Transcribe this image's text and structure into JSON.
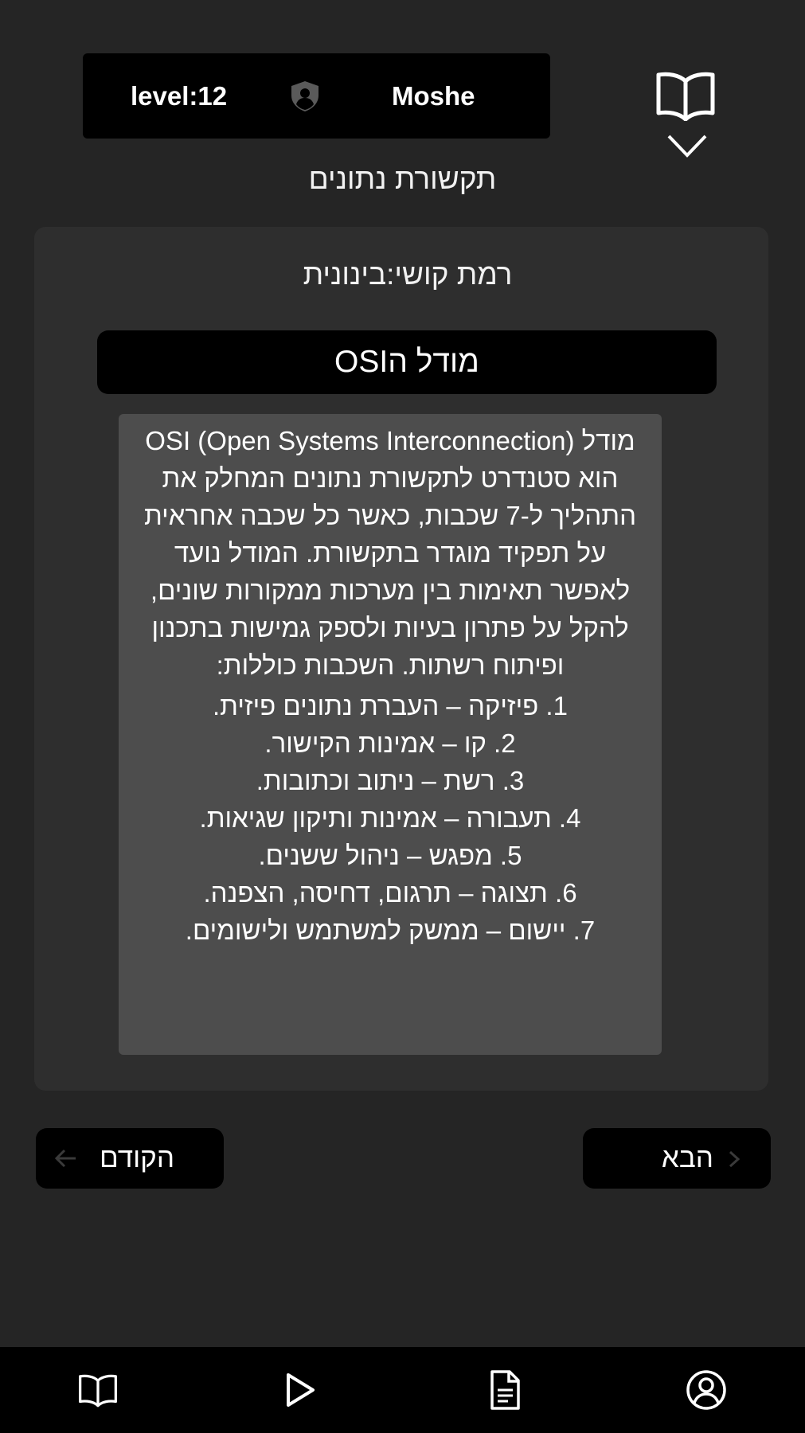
{
  "header": {
    "level_text": "level:12",
    "username": "Moshe",
    "avatar_icon": "shield-user-icon"
  },
  "top_actions": {
    "book_icon": "book-open-icon",
    "expand_icon": "chevron-down-icon"
  },
  "subject": "תקשורת נתונים",
  "card": {
    "difficulty": "רמת קושי:בינונית",
    "topic_title": "מודל הOSI",
    "intro": "מודל OSI (Open Systems Interconnection) הוא סטנדרט לתקשורת נתונים המחלק את התהליך ל-7 שכבות, כאשר כל שכבה אחראית על תפקיד מוגדר בתקשורת. המודל נועד לאפשר תאימות בין מערכות ממקורות שונים, להקל על פתרון בעיות ולספק גמישות בתכנון ופיתוח רשתות. השכבות כוללות:",
    "layers": [
      "1. פיזיקה – העברת נתונים פיזית.",
      "2. קו – אמינות הקישור.",
      "3. רשת – ניתוב וכתובות.",
      "4. תעבורה – אמינות ותיקון שגיאות.",
      "5. מפגש – ניהול ששנים.",
      "6. תצוגה – תרגום, דחיסה, הצפנה.",
      "7. יישום – ממשק למשתמש ולישומים."
    ]
  },
  "navigation": {
    "prev_label": "הקודם",
    "next_label": "הבא",
    "prev_icon": "arrow-left-icon",
    "next_icon": "chevron-right-icon"
  },
  "bottom_nav": {
    "items": [
      {
        "name": "books",
        "icon": "book-open-icon"
      },
      {
        "name": "play",
        "icon": "play-icon"
      },
      {
        "name": "documents",
        "icon": "document-icon"
      },
      {
        "name": "profile",
        "icon": "user-circle-icon"
      }
    ]
  },
  "colors": {
    "background": "#252525",
    "card": "#2e2e2e",
    "content_box": "#4d4d4d",
    "bar": "#000000",
    "text": "#ffffff"
  }
}
